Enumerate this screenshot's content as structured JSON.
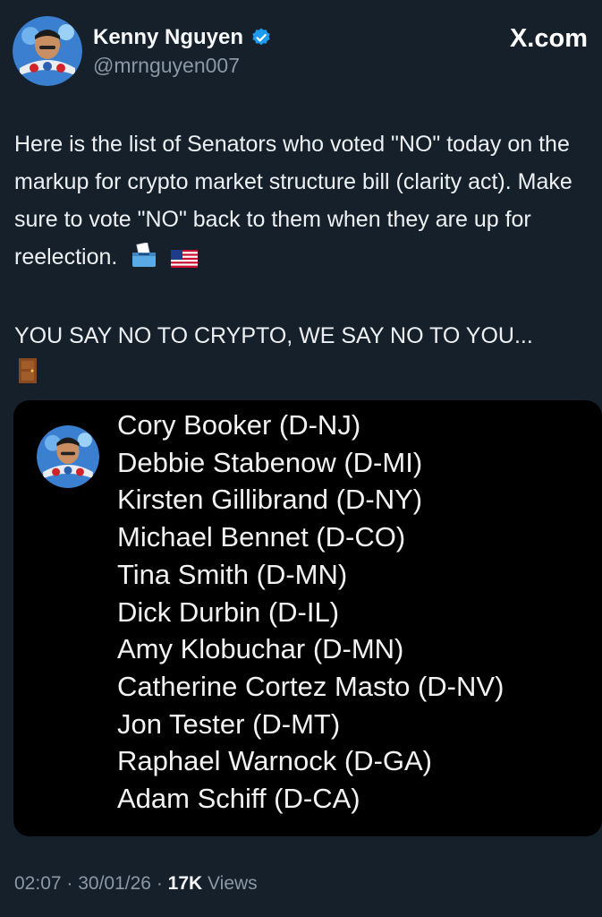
{
  "user": {
    "display_name": "Kenny Nguyen",
    "handle": "@mrnguyen007",
    "verified": true
  },
  "brand": "X.com",
  "tweet": {
    "paragraph_1": "Here is the list of Senators who voted \"NO\" today on the markup for crypto market structure bill (clarity act). Make sure to vote \"NO\" back to them when they are up for reelection.",
    "paragraph_1_emojis": [
      "ballot-box-icon",
      "us-flag-icon"
    ],
    "paragraph_2": "YOU SAY NO TO CRYPTO, WE SAY NO TO YOU...",
    "paragraph_2_emoji": "door-icon"
  },
  "media": {
    "senators": [
      "Cory Booker (D-NJ)",
      "Debbie Stabenow (D-MI)",
      "Kirsten Gillibrand (D-NY)",
      "Michael Bennet (D-CO)",
      "Tina Smith (D-MN)",
      "Dick Durbin (D-IL)",
      "Amy Klobuchar (D-MN)",
      "Catherine Cortez Masto (D-NV)",
      "Jon Tester (D-MT)",
      "Raphael Warnock (D-GA)",
      "Adam Schiff (D-CA)"
    ]
  },
  "meta": {
    "time": "02:07",
    "separator": " · ",
    "date": "30/01/26",
    "views_count": "17K",
    "views_label": " Views"
  },
  "colors": {
    "background": "#15202b",
    "text": "#e7e9ea",
    "secondary_text": "#8b98a5",
    "verified_badge": "#1d9bf0",
    "card_background": "#000000"
  }
}
